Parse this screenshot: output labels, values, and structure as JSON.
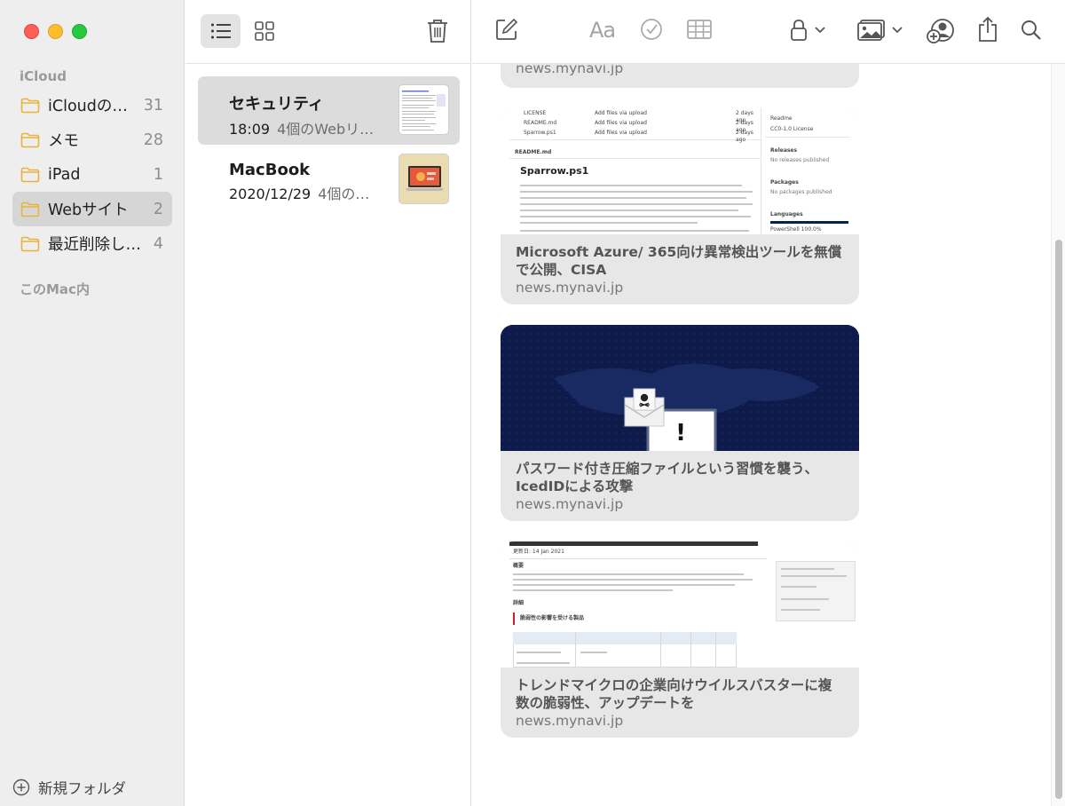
{
  "sidebar": {
    "section_icloud": "iCloud",
    "section_mac": "このMac内",
    "folders": [
      {
        "name": "iCloudの…",
        "count": "31"
      },
      {
        "name": "メモ",
        "count": "28"
      },
      {
        "name": "iPad",
        "count": "1"
      },
      {
        "name": "Webサイト",
        "count": "2"
      },
      {
        "name": "最近削除し…",
        "count": "4"
      }
    ],
    "new_folder_label": "新規フォルダ"
  },
  "notes": [
    {
      "title": "セキュリティ",
      "time": "18:09",
      "preview": "4個のWebリ…"
    },
    {
      "title": "MacBook",
      "time": "2020/12/29",
      "preview": "4個の…"
    }
  ],
  "editor": {
    "format_label": "Aa",
    "cards": [
      {
        "title": "",
        "domain": "news.mynavi.jp"
      },
      {
        "title": "Microsoft Azure/ 365向け異常検出ツールを無償で公開、CISA",
        "domain": "news.mynavi.jp",
        "img": {
          "heading": "Sparrow.ps1",
          "readme": "README.md",
          "files": [
            "LICENSE",
            "README.md",
            "Sparrow.ps1"
          ],
          "commit": "Add files via upload",
          "age": "2 days ago",
          "side": [
            "Readme",
            "CC0-1.0 License",
            "Releases",
            "No releases published",
            "Packages",
            "No packages published",
            "Languages",
            "PowerShell 100.0%"
          ]
        }
      },
      {
        "title": "パスワード付き圧縮ファイルという習慣を襲う、IcedIDによる攻撃",
        "domain": "news.mynavi.jp"
      },
      {
        "title": "トレンドマイクロの企業向けウイルスバスターに複数の脆弱性、アップデートを",
        "domain": "news.mynavi.jp",
        "img": {
          "updated": "更新日: 14 Jan 2021",
          "overview": "概要",
          "detail": "詳細",
          "affected": "脆弱性の影響を受ける製品"
        }
      }
    ]
  },
  "colors": {
    "accent_folder": "#e8b33a",
    "selection": "#dcdcdc"
  }
}
